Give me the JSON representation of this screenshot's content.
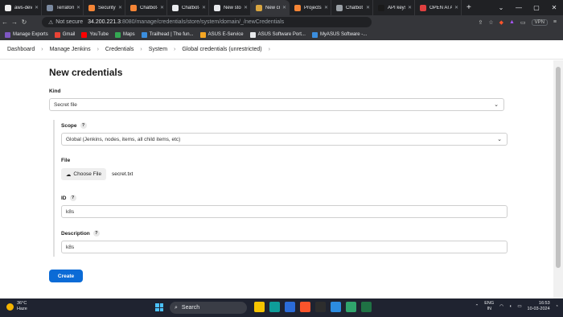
{
  "browser": {
    "tabs": [
      {
        "label": "aws-devops",
        "color": "#f0f0f0",
        "active": false
      },
      {
        "label": "Terraform Inst",
        "color": "#7b8aa0",
        "active": false
      },
      {
        "label": "SecurityGroup",
        "color": "#f58536",
        "active": false
      },
      {
        "label": "Chatbot-EKS",
        "color": "#f58536",
        "active": false
      },
      {
        "label": "Chatbot-UI/k",
        "color": "#e8eaed",
        "active": false
      },
      {
        "label": "New story –",
        "color": "#e8eaed",
        "active": false
      },
      {
        "label": "New cre",
        "color": "#d9a640",
        "active": true
      },
      {
        "label": "Projects",
        "color": "#f58536",
        "active": false
      },
      {
        "label": "Chatbot UI",
        "color": "#9aa0a6",
        "active": false
      },
      {
        "label": "API keys - O",
        "color": "#1a1a1a",
        "active": false
      },
      {
        "label": "OPEN AI API",
        "color": "#e04040",
        "active": false
      }
    ],
    "new_tab": "+",
    "window_controls": [
      "⌄",
      "—",
      "▢",
      "✕"
    ],
    "address": {
      "security_label": "Not secure",
      "host": "34.200.221.3",
      "path": ":8080/manage/credentials/store/system/domain/_/newCredentials"
    },
    "vpn_label": "VPN",
    "bookmarks": [
      {
        "label": "Manage Exports",
        "color": "#7e57c2"
      },
      {
        "label": "Gmail",
        "color": "#ea4335"
      },
      {
        "label": "YouTube",
        "color": "#ff0000"
      },
      {
        "label": "Maps",
        "color": "#34a853"
      },
      {
        "label": "Trailhead | The fun...",
        "color": "#3b8ede"
      },
      {
        "label": "ASUS E-Service",
        "color": "#f5a623"
      },
      {
        "label": "ASUS Software Port...",
        "color": "#e8eaed"
      },
      {
        "label": "MyASUS Software -...",
        "color": "#3b8ede"
      }
    ]
  },
  "breadcrumb": [
    "Dashboard",
    "Manage Jenkins",
    "Credentials",
    "System",
    "Global credentials (unrestricted)"
  ],
  "form": {
    "title": "New credentials",
    "kind_label": "Kind",
    "kind_value": "Secret file",
    "scope_label": "Scope",
    "scope_value": "Global (Jenkins, nodes, items, all child items, etc)",
    "file_label": "File",
    "choose_file_label": "Choose File",
    "file_name": "secret.txt",
    "id_label": "ID",
    "id_value": "k8s",
    "description_label": "Description",
    "description_value": "k8s",
    "create_label": "Create",
    "help_glyph": "?"
  },
  "taskbar": {
    "temperature": "36°C",
    "weather": "Haze",
    "search_placeholder": "Search",
    "language": "ENG",
    "region": "IN",
    "time": "16:53",
    "date": "10-03-2024",
    "apps": [
      {
        "name": "file-explorer-icon",
        "color": "#f5c400"
      },
      {
        "name": "edge-icon",
        "color": "#0f9d9a"
      },
      {
        "name": "photos-icon",
        "color": "#2b6cd8"
      },
      {
        "name": "brave-icon",
        "color": "#fb542b"
      },
      {
        "name": "terminal-icon",
        "color": "#2d2d2d"
      },
      {
        "name": "vscode-icon",
        "color": "#2c8ce0"
      },
      {
        "name": "notepad-icon",
        "color": "#30a46c"
      },
      {
        "name": "excel-icon",
        "color": "#1f7244"
      }
    ]
  }
}
